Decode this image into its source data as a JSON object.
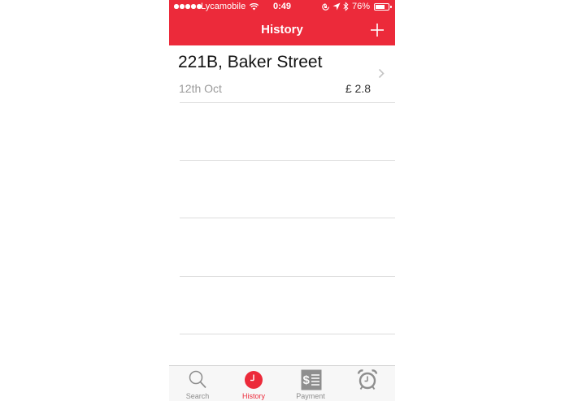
{
  "colors": {
    "accent": "#ec2a3a",
    "inactive": "#8e8e8e"
  },
  "status_bar": {
    "carrier": "Lycamobile",
    "time": "0:49",
    "battery": "76%",
    "battery_level_percent": 76
  },
  "nav": {
    "title": "History",
    "add_icon": "plus-icon"
  },
  "history": {
    "items": [
      {
        "address": "221B, Baker Street",
        "date": "12th Oct",
        "price": "£ 2.8"
      }
    ]
  },
  "tabs": [
    {
      "label": "Search",
      "icon": "magnifier-icon",
      "active": false
    },
    {
      "label": "History",
      "icon": "clock-icon",
      "active": true
    },
    {
      "label": "Payment",
      "icon": "receipt-dollar-icon",
      "active": false
    },
    {
      "label": "",
      "icon": "alarm-clock-icon",
      "active": false
    }
  ]
}
